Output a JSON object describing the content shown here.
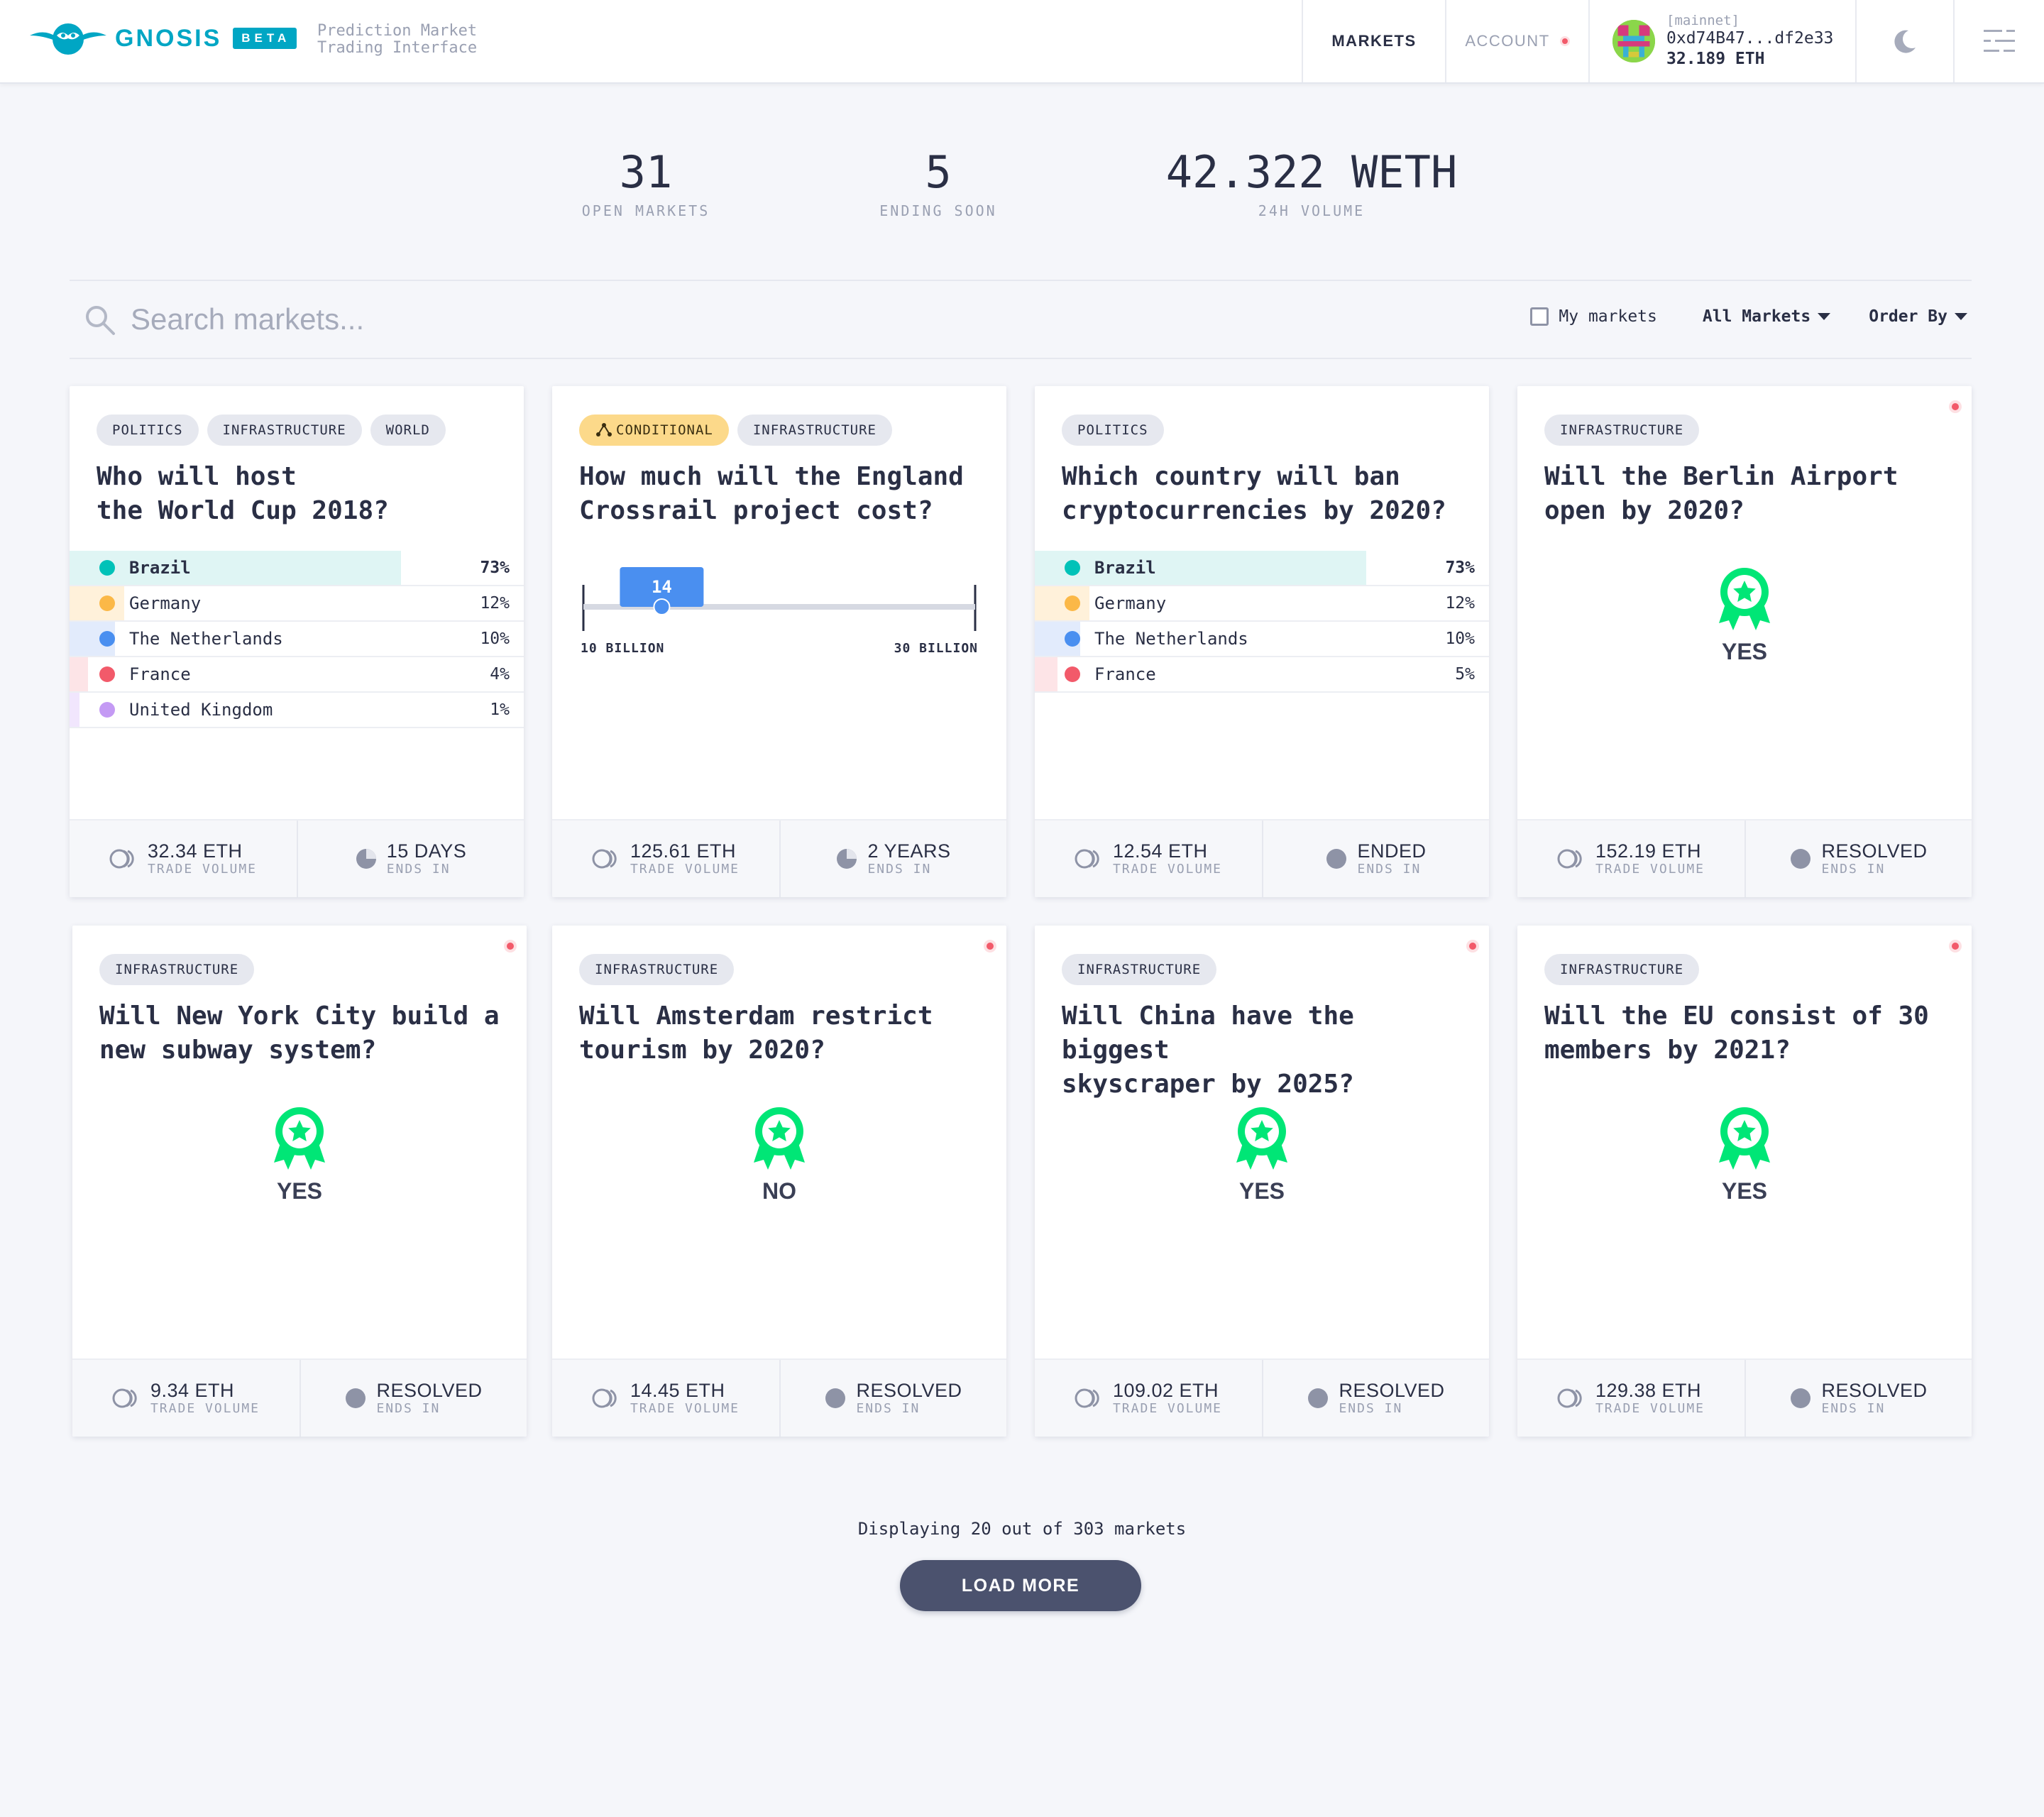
{
  "header": {
    "brand": "GNOSIS",
    "beta": "BETA",
    "tagline": "Prediction Market\nTrading Interface",
    "nav_markets": "MARKETS",
    "nav_account": "ACCOUNT",
    "wallet": {
      "network": "[mainnet]",
      "address": "0xd74B47...df2e33",
      "balance": "32.189 ETH"
    },
    "icons": {
      "theme": "moon-icon",
      "menu": "menu-icon"
    }
  },
  "stats": [
    {
      "value": "31",
      "label": "OPEN MARKETS"
    },
    {
      "value": "5",
      "label": "ENDING SOON"
    },
    {
      "value": "42.322 WETH",
      "label": "24H VOLUME"
    }
  ],
  "search": {
    "placeholder": "Search markets..."
  },
  "filters": {
    "my_markets": "My markets",
    "all_markets": "All Markets",
    "order_by": "Order By"
  },
  "colors": {
    "accent": "#00a6c4",
    "win": "#00e676",
    "resolved": "#f25a6a",
    "button": "#4b526e"
  },
  "markets": [
    {
      "tags": [
        "POLITICS",
        "INFRASTRUCTURE",
        "WORLD"
      ],
      "title": "Who will host\nthe World Cup 2018?",
      "outcomes": [
        {
          "name": "Brazil",
          "pct": "73%",
          "share": 0.73,
          "color": "#00c2b8",
          "bg": "#dff5f4"
        },
        {
          "name": "Germany",
          "pct": "12%",
          "share": 0.12,
          "color": "#fbb847",
          "bg": "#fff1da"
        },
        {
          "name": "The Netherlands",
          "pct": "10%",
          "share": 0.1,
          "color": "#4a8ff0",
          "bg": "#e2ebfc"
        },
        {
          "name": "France",
          "pct": "4%",
          "share": 0.04,
          "color": "#f25a6a",
          "bg": "#fde4e7"
        },
        {
          "name": "United Kingdom",
          "pct": "1%",
          "share": 0.01,
          "color": "#c49af4",
          "bg": "#f1e6fd"
        }
      ],
      "volume": "32.34 ETH",
      "volume_label": "TRADE VOLUME",
      "ends": "15 DAYS",
      "ends_label": "ENDS IN",
      "status": "open"
    },
    {
      "tags": [
        "CONDITIONAL",
        "INFRASTRUCTURE"
      ],
      "title": "How much will the England\nCrossrail project cost?",
      "scalar": {
        "value": "14",
        "min": 10,
        "max": 30,
        "min_label": "10 BILLION",
        "max_label": "30 BILLION",
        "current": 14
      },
      "volume": "125.61 ETH",
      "volume_label": "TRADE VOLUME",
      "ends": "2 YEARS",
      "ends_label": "ENDS IN",
      "status": "open"
    },
    {
      "tags": [
        "POLITICS"
      ],
      "title": "Which country will ban\ncryptocurrencies by 2020?",
      "outcomes": [
        {
          "name": "Brazil",
          "pct": "73%",
          "share": 0.73,
          "color": "#00c2b8",
          "bg": "#dff5f4"
        },
        {
          "name": "Germany",
          "pct": "12%",
          "share": 0.12,
          "color": "#fbb847",
          "bg": "#fff1da"
        },
        {
          "name": "The Netherlands",
          "pct": "10%",
          "share": 0.1,
          "color": "#4a8ff0",
          "bg": "#e2ebfc"
        },
        {
          "name": "France",
          "pct": "5%",
          "share": 0.05,
          "color": "#f25a6a",
          "bg": "#fde4e7"
        }
      ],
      "volume": "12.54 ETH",
      "volume_label": "TRADE VOLUME",
      "ends": "ENDED",
      "ends_label": "ENDS IN",
      "status": "ended"
    },
    {
      "tags": [
        "INFRASTRUCTURE"
      ],
      "title": "Will the Berlin Airport\nopen by 2020?",
      "winner": "YES",
      "volume": "152.19 ETH",
      "volume_label": "TRADE VOLUME",
      "ends": "RESOLVED",
      "ends_label": "ENDS IN",
      "status": "resolved"
    },
    {
      "tags": [
        "INFRASTRUCTURE"
      ],
      "title": "Will New York City build a\nnew subway system?",
      "winner": "YES",
      "volume": "9.34 ETH",
      "volume_label": "TRADE VOLUME",
      "ends": "RESOLVED",
      "ends_label": "ENDS IN",
      "status": "resolved"
    },
    {
      "tags": [
        "INFRASTRUCTURE"
      ],
      "title": "Will Amsterdam restrict\ntourism by 2020?",
      "winner": "NO",
      "volume": "14.45 ETH",
      "volume_label": "TRADE VOLUME",
      "ends": "RESOLVED",
      "ends_label": "ENDS IN",
      "status": "resolved"
    },
    {
      "tags": [
        "INFRASTRUCTURE"
      ],
      "title": "Will China have the biggest\nskyscraper by 2025?",
      "winner": "YES",
      "volume": "109.02 ETH",
      "volume_label": "TRADE VOLUME",
      "ends": "RESOLVED",
      "ends_label": "ENDS IN",
      "status": "resolved"
    },
    {
      "tags": [
        "INFRASTRUCTURE"
      ],
      "title": "Will the EU consist of 30\nmembers by 2021?",
      "winner": "YES",
      "volume": "129.38 ETH",
      "volume_label": "TRADE VOLUME",
      "ends": "RESOLVED",
      "ends_label": "ENDS IN",
      "status": "resolved"
    }
  ],
  "footer": {
    "displaying": "Displaying 20 out of 303 markets",
    "load_more": "LOAD MORE"
  }
}
